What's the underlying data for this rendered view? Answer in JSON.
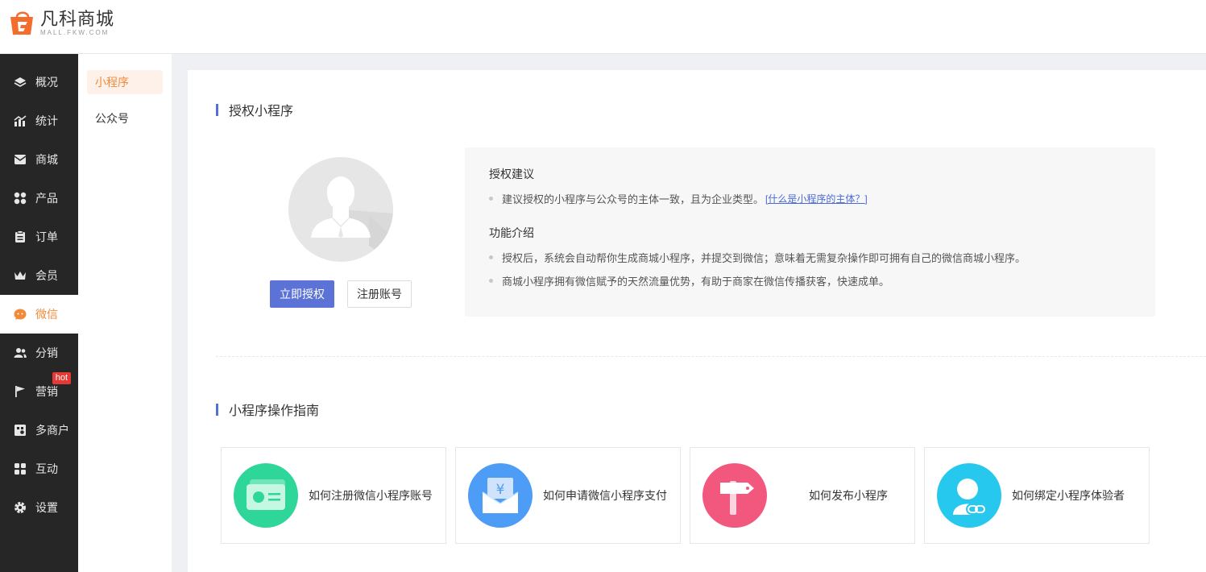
{
  "brand": {
    "name": "凡科商城",
    "subtitle": "MALL.FKW.COM"
  },
  "sidebar": {
    "items": [
      {
        "label": "概况",
        "icon": "layers-icon"
      },
      {
        "label": "统计",
        "icon": "chart-icon"
      },
      {
        "label": "商城",
        "icon": "mail-icon"
      },
      {
        "label": "产品",
        "icon": "grid-icon"
      },
      {
        "label": "订单",
        "icon": "clipboard-icon"
      },
      {
        "label": "会员",
        "icon": "crown-icon"
      },
      {
        "label": "微信",
        "icon": "wechat-icon"
      },
      {
        "label": "分销",
        "icon": "users-icon"
      },
      {
        "label": "营销",
        "icon": "flag-icon",
        "badge": "hot"
      },
      {
        "label": "多商户",
        "icon": "store-icon"
      },
      {
        "label": "互动",
        "icon": "apps-icon"
      },
      {
        "label": "设置",
        "icon": "gear-icon"
      }
    ]
  },
  "subnav": {
    "items": [
      "小程序",
      "公众号"
    ]
  },
  "auth": {
    "title": "授权小程序",
    "authorize_button": "立即授权",
    "register_button": "注册账号",
    "suggest_title": "授权建议",
    "suggest_text": "建议授权的小程序与公众号的主体一致，且为企业类型。",
    "suggest_link": "[什么是小程序的主体？]",
    "feature_title": "功能介绍",
    "feature_1": "授权后，系统会自动帮你生成商城小程序，并提交到微信；意味着无需复杂操作即可拥有自己的微信商城小程序。",
    "feature_2": "商城小程序拥有微信赋予的天然流量优势，有助于商家在微信传播获客，快速成单。"
  },
  "guide": {
    "title": "小程序操作指南",
    "cards": [
      {
        "label": "如何注册微信小程序账号",
        "icon": "id-card-icon",
        "color": "#2fd69a"
      },
      {
        "label": "如何申请微信小程序支付",
        "icon": "yuan-envelope-icon",
        "color": "#4d9cf6"
      },
      {
        "label": "如何发布小程序",
        "icon": "signpost-icon",
        "color": "#f2577e"
      },
      {
        "label": "如何绑定小程序体验者",
        "icon": "user-link-icon",
        "color": "#27c8ee"
      }
    ]
  },
  "colors": {
    "accent": "#f08b3a",
    "primary": "#5b73d6",
    "nav_bg": "#262626",
    "hot": "#e53935"
  }
}
